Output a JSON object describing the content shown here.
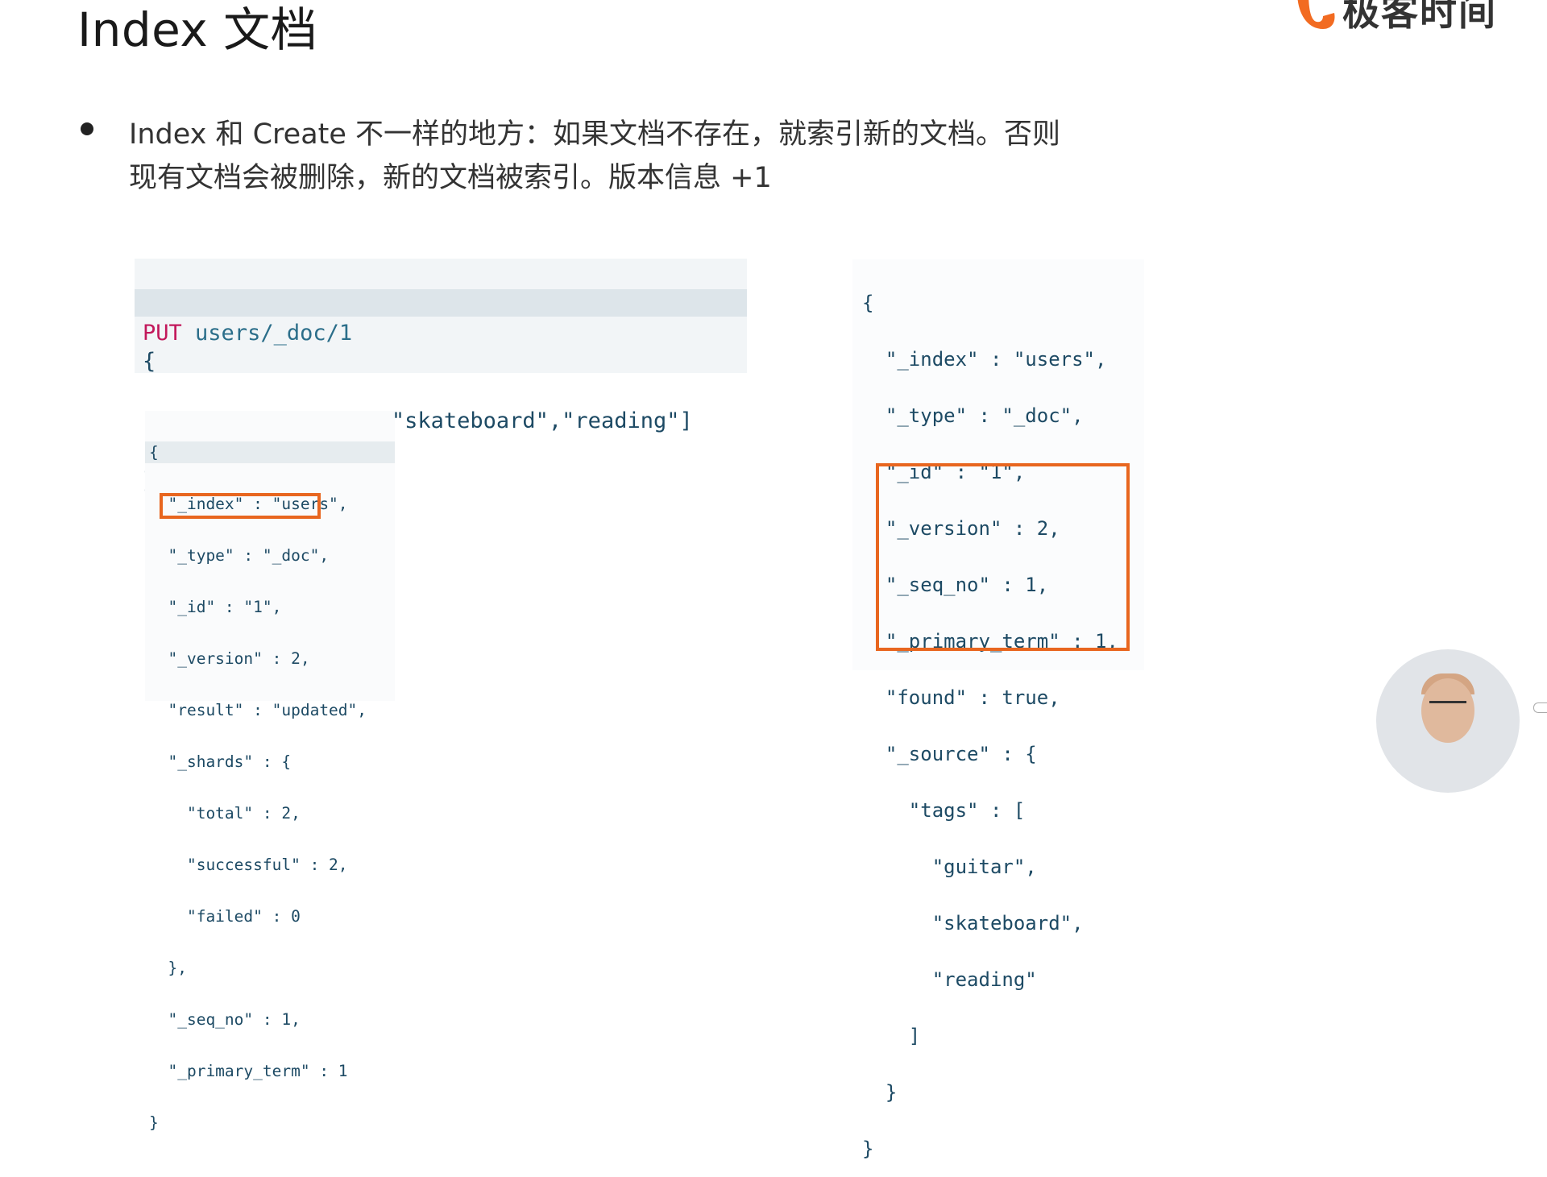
{
  "slide": {
    "title": "Index 文档",
    "logo": {
      "text": "极客时间",
      "color": "#f26b21",
      "icon": "geektime-logo-icon"
    },
    "bullet": {
      "line1": "Index 和 Create 不一样的地方：如果文档不存在，就索引新的文档。否则",
      "line2": "现有文档会被删除，新的文档被索引。版本信息 +1"
    }
  },
  "request": {
    "method": "PUT",
    "path": "users/_doc/1",
    "open_brace": "{",
    "body_line": "  \"tags\":[\"guitar\",\"skateboard\",\"reading\"]",
    "close_brace": "}"
  },
  "response_index": [
    "{",
    "  \"_index\" : \"users\",",
    "  \"_type\" : \"_doc\",",
    "  \"_id\" : \"1\",",
    "  \"_version\" : 2,",
    "  \"result\" : \"updated\",",
    "  \"_shards\" : {",
    "    \"total\" : 2,",
    "    \"successful\" : 2,",
    "    \"failed\" : 0",
    "  },",
    "  \"_seq_no\" : 1,",
    "  \"_primary_term\" : 1",
    "}"
  ],
  "response_get": [
    "{",
    "  \"_index\" : \"users\",",
    "  \"_type\" : \"_doc\",",
    "  \"_id\" : \"1\",",
    "  \"_version\" : 2,",
    "  \"_seq_no\" : 1,",
    "  \"_primary_term\" : 1,",
    "  \"found\" : true,",
    "  \"_source\" : {",
    "    \"tags\" : [",
    "      \"guitar\",",
    "      \"skateboard\",",
    "      \"reading\"",
    "    ]",
    "  }",
    "}"
  ],
  "colors": {
    "highlight": "#e8661f",
    "keyword": "#c2185b",
    "string": "#196a31",
    "key": "#1e5f7d"
  }
}
